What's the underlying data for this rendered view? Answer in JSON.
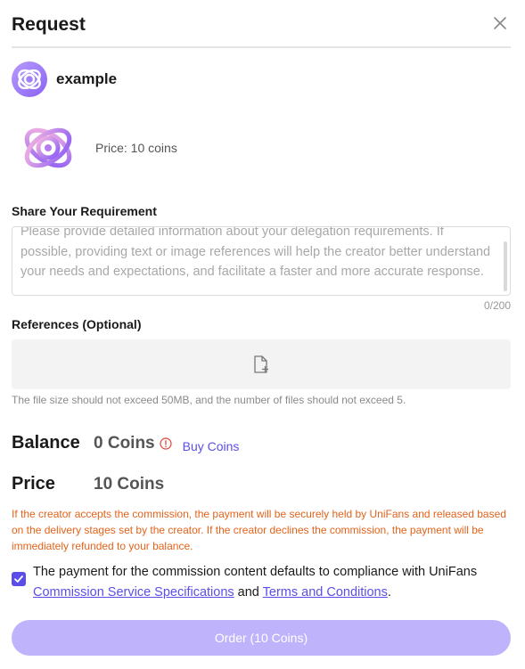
{
  "modal": {
    "title": "Request"
  },
  "creator": {
    "name": "example"
  },
  "product": {
    "price_text": "Price: 10 coins"
  },
  "requirement": {
    "label": "Share Your Requirement",
    "text": "Please provide detailed information about your delegation requirements. If possible, providing text or image references will help the creator better understand your needs and expectations, and facilitate a faster and more accurate response.",
    "counter": "0/200"
  },
  "references": {
    "label": "References (Optional)",
    "note": "The file size should not exceed 50MB, and the number of files should not exceed 5."
  },
  "balance": {
    "label": "Balance",
    "value": "0 Coins",
    "buy_label": "Buy Coins"
  },
  "price": {
    "label": "Price",
    "value": "10 Coins"
  },
  "warning": "If the creator accepts the commission, the payment will be securely held by UniFans and released based on the delivery stages set by the creator. If the creator declines the commission, the payment will be immediately refunded to your balance.",
  "agreement": {
    "checked": true,
    "text_before": "The payment for the commission content defaults to compliance with UniFans ",
    "link1": "Commission Service Specifications",
    "text_mid": " and ",
    "link2": "Terms and Conditions",
    "text_after": "."
  },
  "order_button": "Order (10 Coins)",
  "colors": {
    "accent": "#5b4ee8",
    "warning": "#e2631b",
    "button_disabled": "#bfb4fb"
  },
  "icons": {
    "close": "close-icon",
    "upload": "file-add-icon",
    "info": "info-icon",
    "check": "check-icon"
  }
}
